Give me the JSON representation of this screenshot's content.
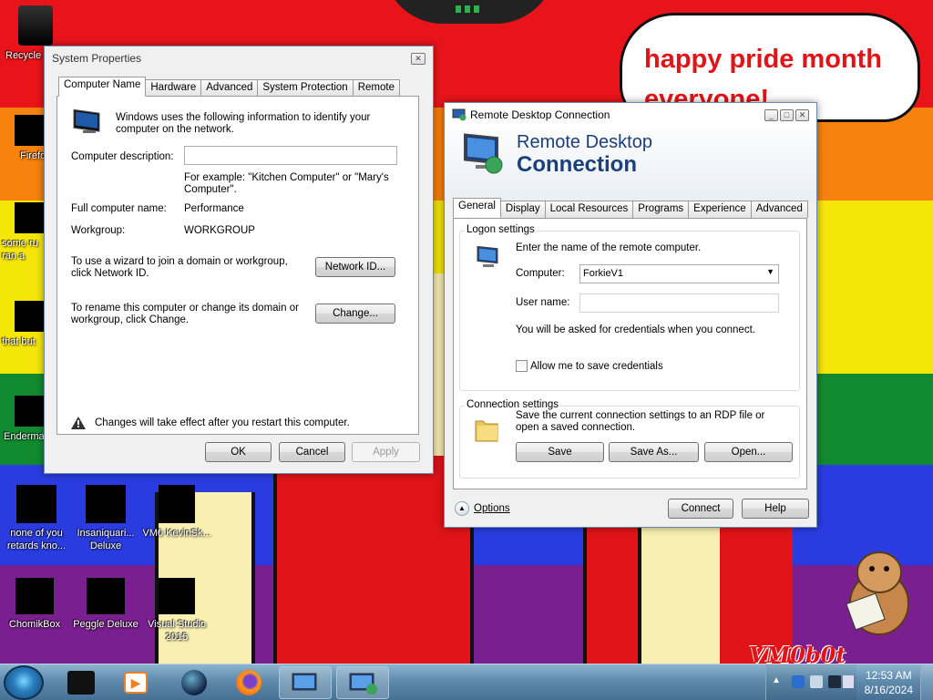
{
  "speech_bubble": {
    "line1": "happy pride month",
    "line2": "everyone!"
  },
  "watermark": "VM0b0t",
  "desktop_icons": [
    {
      "label": "Recycle"
    },
    {
      "label": "Firefo"
    },
    {
      "label": "some ru ran a"
    },
    {
      "label": "that but"
    },
    {
      "label": "Enderma"
    },
    {
      "label": "none of you retards kno..."
    },
    {
      "label": "Insaniquari... Deluxe"
    },
    {
      "label": "VM0 KevinSk..."
    },
    {
      "label": "ChomikBox"
    },
    {
      "label": "Peggle Deluxe"
    },
    {
      "label": "Visual Studio 2015"
    }
  ],
  "system_properties": {
    "title": "System Properties",
    "tabs": [
      "Computer Name",
      "Hardware",
      "Advanced",
      "System Protection",
      "Remote"
    ],
    "intro": "Windows uses the following information to identify your computer on the network.",
    "description_label": "Computer description:",
    "description_value": "",
    "example": "For example: \"Kitchen Computer\" or \"Mary's Computer\".",
    "full_name_label": "Full computer name:",
    "full_name_value": "Performance",
    "workgroup_label": "Workgroup:",
    "workgroup_value": "WORKGROUP",
    "network_id_text": "To use a wizard to join a domain or workgroup, click Network ID.",
    "network_id_button": "Network ID...",
    "rename_text": "To rename this computer or change its domain or workgroup, click Change.",
    "change_button": "Change...",
    "warning": "Changes will take effect after you restart this computer.",
    "ok": "OK",
    "cancel": "Cancel",
    "apply": "Apply"
  },
  "rdc": {
    "title": "Remote Desktop Connection",
    "banner_line1": "Remote Desktop",
    "banner_line2": "Connection",
    "tabs": [
      "General",
      "Display",
      "Local Resources",
      "Programs",
      "Experience",
      "Advanced"
    ],
    "logon_group": "Logon settings",
    "logon_intro": "Enter the name of the remote computer.",
    "computer_label": "Computer:",
    "computer_value": "ForkieV1",
    "username_label": "User name:",
    "username_value": "",
    "credentials_note": "You will be asked for credentials when you connect.",
    "allow_save_label": "Allow me to save credentials",
    "allow_save_checked": false,
    "connection_group": "Connection settings",
    "connection_text": "Save the current connection settings to an RDP file or open a saved connection.",
    "save": "Save",
    "save_as": "Save As...",
    "open": "Open...",
    "options": "Options",
    "connect": "Connect",
    "help": "Help"
  },
  "taskbar": {
    "time": "12:53 AM",
    "date": "8/16/2024",
    "items": [
      "terminal-icon",
      "media-player-icon",
      "globe-icon",
      "firefox-icon",
      "system-properties-icon",
      "remote-desktop-icon"
    ]
  }
}
